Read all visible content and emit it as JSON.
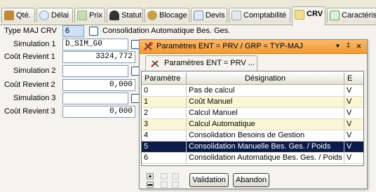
{
  "tabs": [
    {
      "label": "Qté.",
      "icon": "box-icon",
      "color": "#c08a3a",
      "active": false
    },
    {
      "label": "Délai",
      "icon": "clock-icon",
      "color": "#7fa4cf",
      "active": false
    },
    {
      "label": "Prix",
      "icon": "price-tag-icon",
      "color": "#8fb870",
      "active": false
    },
    {
      "label": "Statut",
      "icon": "person-icon",
      "color": "#333333",
      "active": false
    },
    {
      "label": "Blocage",
      "icon": "lock-badge-icon",
      "color": "#c9a04a",
      "active": false
    },
    {
      "label": "Devis",
      "icon": "pencil-icon",
      "color": "#6c8fbf",
      "active": false
    },
    {
      "label": "Comptabilité",
      "icon": "ledger-icon",
      "color": "#9aa4ae",
      "active": false
    },
    {
      "label": "CRV",
      "icon": "calculator-icon",
      "color": "#d4a640",
      "active": true
    },
    {
      "label": "Caractéris",
      "icon": "sheet-icon",
      "color": "#6aa36a",
      "active": false
    }
  ],
  "form": {
    "type_maj_crv_label": "Type MAJ CRV",
    "type_maj_crv_value": "6",
    "consolidation_label": "Consolidation Automatique Bes. Ges.",
    "rows": [
      {
        "label": "Simulation 1",
        "value": "D_SIM_G0"
      },
      {
        "label": "Coût Revient 1",
        "value": "3324,772"
      },
      {
        "label": "Simulation 2",
        "value": ""
      },
      {
        "label": "Coût Revient 2",
        "value": "0,000"
      },
      {
        "label": "Simulation 3",
        "value": ""
      },
      {
        "label": "Coût Revient 3",
        "value": "0,000"
      }
    ]
  },
  "panel": {
    "title": "Paramètres ENT = PRV /  GRP =  TYP-MAJ",
    "subtab": "Paramètres ENT = PRV ...",
    "btn_dropdown": "▼",
    "btn_pin": "‡",
    "btn_close": "×",
    "columns": [
      "Paramètre",
      "Désignation",
      "E"
    ],
    "rows": [
      {
        "param": "0",
        "designation": "Pas de calcul",
        "e": "V"
      },
      {
        "param": "1",
        "designation": "Coût Manuel",
        "e": "V"
      },
      {
        "param": "2",
        "designation": "Calcul Manuel",
        "e": "V"
      },
      {
        "param": "3",
        "designation": "Calcul Automatique",
        "e": "V"
      },
      {
        "param": "4",
        "designation": "Consolidation Besoins de Gestion",
        "e": "V"
      },
      {
        "param": "5",
        "designation": "Consolidation Manuelle Bes. Ges. / Poids",
        "e": "V"
      },
      {
        "param": "6",
        "designation": "Consolidation Automatique Bes. Ges. / Poids",
        "e": "V"
      }
    ],
    "selected_row": 5,
    "validation_label": "Validation",
    "abandon_label": "Abandon",
    "colors": {
      "title_bar": "#f09a34",
      "selected_row": "#0a1a4a",
      "alt_row": "#fbf7d6"
    }
  }
}
